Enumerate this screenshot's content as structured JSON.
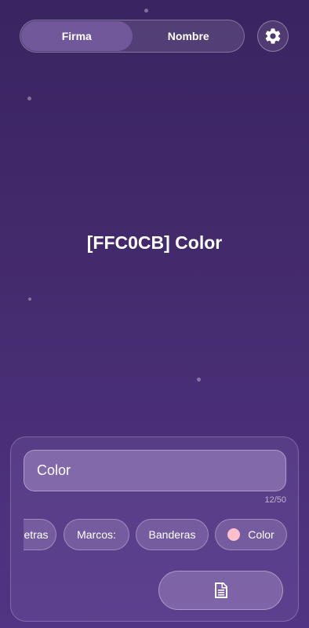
{
  "tabs": [
    {
      "label": "Firma",
      "active": true
    },
    {
      "label": "Nombre",
      "active": false
    }
  ],
  "settings": {
    "icon": "gear-icon"
  },
  "preview": {
    "text": "[FFC0CB] Color"
  },
  "input": {
    "value": "Color",
    "counter": "12/50"
  },
  "chips": [
    {
      "label": "etras",
      "icon": null
    },
    {
      "label": "Marcos:",
      "icon": null
    },
    {
      "label": "Banderas",
      "icon": null
    },
    {
      "label": "Color",
      "icon": "color-swatch",
      "swatch_color": "#FFC0CB"
    }
  ],
  "action": {
    "icon": "document-icon"
  },
  "colors": {
    "accent": "#FFC0CB",
    "background": "#432a6c"
  }
}
